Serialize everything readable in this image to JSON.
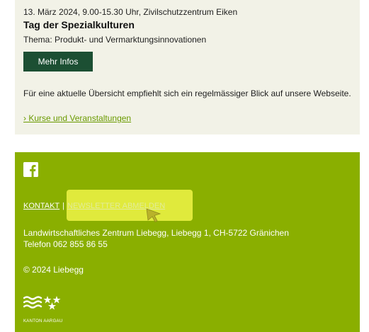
{
  "event": {
    "date": "13. März 2024, 9.00-15.30 Uhr, Zivilschutzzentrum Eiken",
    "title": "Tag der Spezialkulturen",
    "theme": "Thema: Produkt- und Vermarktungsinnovationen",
    "button_label": "Mehr Infos",
    "info_text": "Für eine aktuelle Übersicht empfiehlt sich ein regelmässiger Blick auf unsere Webseite.",
    "link_label": "› Kurse und Veranstaltungen"
  },
  "footer": {
    "social_icon": "facebook-icon",
    "nav": {
      "contact": "KONTAKT",
      "separator": "|",
      "newsletter": "NEWSLETTER ABMELDEN"
    },
    "address_line1": "Landwirtschaftliches Zentrum Liebegg, Liebegg 1, CH-5722 Gränichen",
    "address_line2": "Telefon 062 855 86 55",
    "copyright": "© 2024 Liebegg",
    "logo_text": "KANTON AARGAU"
  },
  "colors": {
    "event_bg": "#f2f2e7",
    "button_bg": "#1c4f33",
    "link_green": "#6a9a00",
    "footer_bg": "#8aaf00",
    "highlight": "#eef546"
  }
}
